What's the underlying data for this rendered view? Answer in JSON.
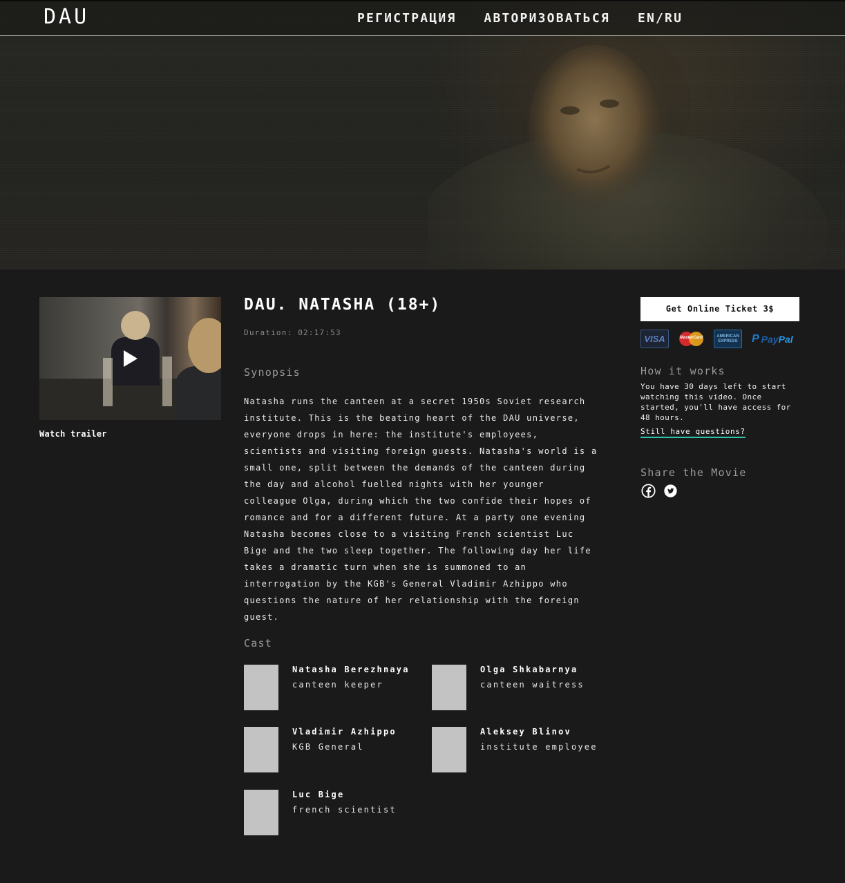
{
  "header": {
    "logo": "DAU",
    "nav": [
      {
        "label": "РЕГИСТРАЦИЯ"
      },
      {
        "label": "АВТОРИЗОВАТЬСЯ"
      },
      {
        "label": "EN/RU"
      }
    ]
  },
  "trailer": {
    "label": "Watch trailer"
  },
  "movie": {
    "title": "DAU. NATASHA (18+)",
    "duration": "Duration: 02:17:53"
  },
  "synopsis": {
    "heading": "Synopsis",
    "text": "Natasha runs the canteen at a secret 1950s Soviet research institute. This is the beating heart of the DAU universe, everyone drops in here: the institute's employees, scientists and visiting foreign guests. Natasha's world is a small one, split between the demands of the canteen during the day and alcohol fuelled nights with her younger colleague Olga, during which the two confide their hopes of romance and for a different future. At a party one evening Natasha becomes close to a visiting French scientist Luc Bige and the two sleep together. The following day her life takes a dramatic turn when she is summoned to an interrogation by the KGB's General Vladimir Azhippo who questions the nature of her relationship with the foreign guest."
  },
  "cast": {
    "heading": "Cast",
    "members": [
      {
        "name": "Natasha Berezhnaya",
        "role": "canteen keeper"
      },
      {
        "name": "Olga Shkabarnya",
        "role": "canteen waitress"
      },
      {
        "name": "Vladimir Azhippo",
        "role": "KGB General"
      },
      {
        "name": "Aleksey Blinov",
        "role": "institute employee"
      },
      {
        "name": "Luc Bige",
        "role": "french scientist"
      }
    ]
  },
  "ticket": {
    "button_label": "Get Online Ticket  3$",
    "payment_methods": [
      "VISA",
      "MasterCard",
      "AMERICAN EXPRESS",
      "PayPal"
    ],
    "amex_line1": "AMERICAN",
    "amex_line2": "EXPRESS",
    "paypal_pay": "Pay",
    "paypal_pal": "Pal"
  },
  "how_it_works": {
    "heading": "How it works",
    "text": "You have 30 days left to start watching this video. Once started, you'll have access for 48 hours.",
    "link": "Still have questions?"
  },
  "share": {
    "heading": "Share the Movie",
    "icons": [
      "facebook-icon",
      "twitter-icon"
    ]
  },
  "colors": {
    "background": "#1a1a1a",
    "link_underline": "#2ec4a6",
    "cast_placeholder": "#c3c3c3"
  }
}
